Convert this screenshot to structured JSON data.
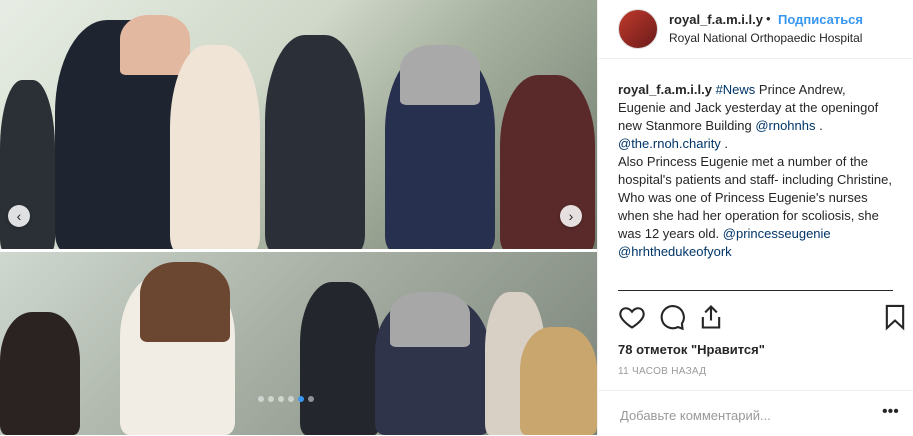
{
  "post": {
    "username": "royal_f.a.m.i.l.y",
    "separator": "•",
    "follow_label": "Подписаться",
    "location": "Royal National Orthopaedic Hospital"
  },
  "caption": {
    "username": "royal_f.a.m.i.l.y",
    "hashtag": "#News",
    "text1": " Prince Andrew, Eugenie and Jack yesterday at the openingof new Stanmore Building ",
    "mention1": "@rnohnhs",
    "text2": " . ",
    "mention2": "@the.rnoh.charity",
    "text3": " .",
    "text4": "Also Princess Eugenie met a number of the hospital's patients and staff- including Christine, Who was one of Princess Eugenie's nurses when she had her operation for scoliosis, she was 12 years old. ",
    "mention3": "@princesseugenie",
    "mention4": "@hrhtheduke​ofyork"
  },
  "engagement": {
    "likes": "78 отметок \"Нравится\"",
    "time": "11 ЧАСОВ НАЗАД"
  },
  "comment": {
    "placeholder": "Добавьте комментарий..."
  },
  "icons": {
    "like": "heart-icon",
    "comment": "comment-icon",
    "share": "share-icon",
    "save": "bookmark-icon",
    "prev": "chevron-left-icon",
    "next": "chevron-right-icon",
    "more": "ellipsis-icon"
  },
  "carousel": {
    "slide_count": 6,
    "active_index": 4,
    "prev_glyph": "‹",
    "next_glyph": "›"
  }
}
